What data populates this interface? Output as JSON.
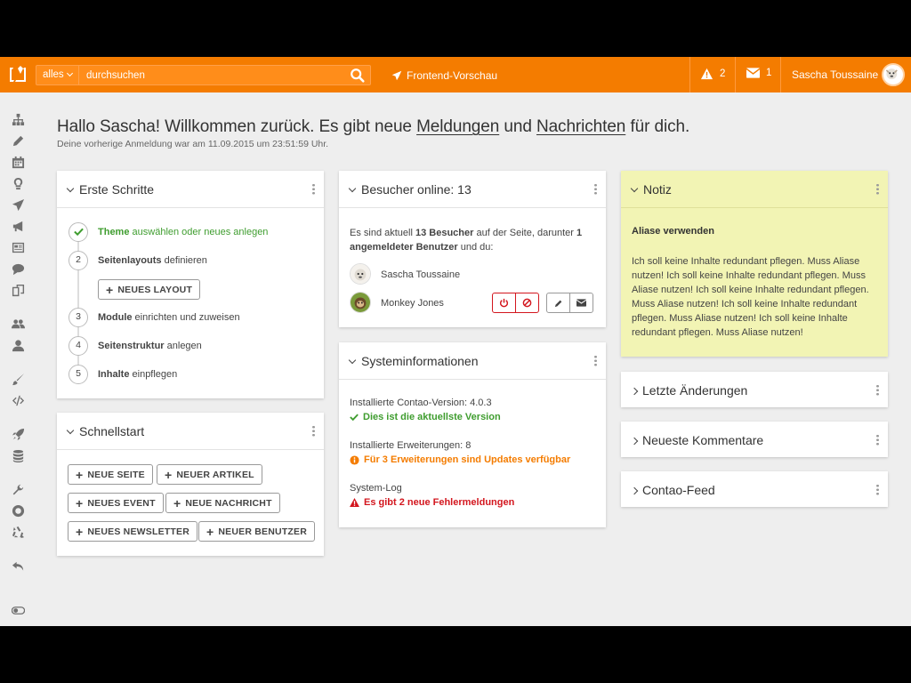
{
  "header": {
    "search_scope": "alles",
    "search_value": "durchsuchen",
    "preview_label": "Frontend-Vorschau",
    "alerts_count": "2",
    "messages_count": "1",
    "username": "Sascha Toussaine",
    "accent_color": "#f47c00"
  },
  "sidebar": {
    "icons": [
      "sitemap-icon",
      "pencil-icon",
      "calendar-icon",
      "lightbulb-icon",
      "paper-plane-icon",
      "bullhorn-icon",
      "newspaper-icon",
      "comments-icon",
      "files-icon",
      "users-icon",
      "user-icon",
      "paint-brush-icon",
      "code-icon",
      "rocket-icon",
      "database-icon",
      "wrench-icon",
      "life-ring-icon",
      "recycle-icon",
      "undo-icon",
      "toggle-icon"
    ]
  },
  "welcome": {
    "prefix": "Hallo Sascha! Willkommen zurück. Es gibt neue ",
    "link1": "Meldungen",
    "mid": " und ",
    "link2": "Nachrichten",
    "suffix": " für dich.",
    "last_login": "Deine vorherige Anmeldung war am 11.09.2015 um 23:51:59 Uhr."
  },
  "first_steps": {
    "title": "Erste Schritte",
    "steps": [
      {
        "num": "✔",
        "strong": "Theme",
        "rest": " auswählen oder neues anlegen",
        "done": true
      },
      {
        "num": "2",
        "strong": "Seitenlayouts",
        "rest": " definieren"
      },
      {
        "num": "3",
        "strong": "Module",
        "rest": " einrichten und zuweisen"
      },
      {
        "num": "4",
        "strong": "Seitenstruktur",
        "rest": " anlegen"
      },
      {
        "num": "5",
        "strong": "Inhalte",
        "rest": " einpflegen"
      }
    ],
    "new_layout_button": "Neues Layout"
  },
  "quickstart": {
    "title": "Schnellstart",
    "buttons": [
      "Neue Seite",
      "Neuer Artikel",
      "Neues Event",
      "Neue Nachricht",
      "Neues Newsletter",
      "Neuer Benutzer"
    ]
  },
  "visitors": {
    "title": "Besucher online: 13",
    "text_a": "Es sind aktuell ",
    "text_b": "13 Besucher",
    "text_c": " auf der Seite, darunter ",
    "text_d": "1",
    "text_e": "angemeldeter Benutzer",
    "text_f": " und du:",
    "users": [
      "Sascha Toussaine",
      "Monkey Jones"
    ]
  },
  "sysinfo": {
    "title": "Systeminformationen",
    "version_label": "Installierte Contao-Version: 4.0.3",
    "version_status": "Dies ist die aktuellste Version",
    "ext_label": "Installierte Erweiterungen: 8",
    "ext_status": "Für 3 Erweiterungen sind Updates verfügbar",
    "log_label": "System-Log",
    "log_status": "Es gibt 2 neue Fehlermeldungen",
    "colors": {
      "ok": "#3f9d2f",
      "warn": "#f47c00",
      "error": "#d3161e"
    }
  },
  "note": {
    "title": "Notiz",
    "heading": "Aliase verwenden",
    "text": "Ich soll keine Inhalte redundant pflegen. Muss Aliase nutzen! Ich soll keine Inhalte redundant pflegen. Muss Aliase nutzen! Ich soll keine Inhalte redundant pflegen. Muss Aliase nutzen! Ich soll keine Inhalte redundant pflegen. Muss Aliase nutzen! Ich soll keine Inhalte redundant pflegen. Muss Aliase nutzen!"
  },
  "collapsed_panels": [
    "Letzte Änderungen",
    "Neueste Kommentare",
    "Contao-Feed"
  ]
}
